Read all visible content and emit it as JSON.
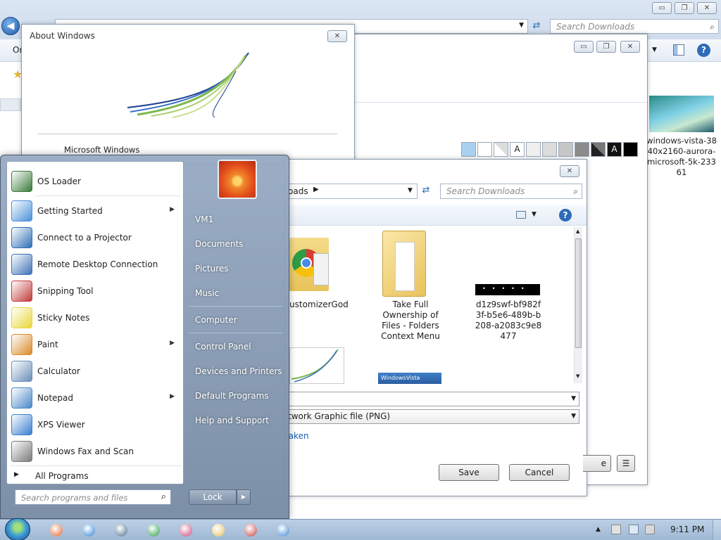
{
  "explorer": {
    "search_placeholder": "Search Downloads",
    "organize_label": "Or",
    "thumbnail_caption": "windows-vista-3840x2160-aurora-microsoft-5k-23361",
    "caption_buttons": {
      "minimize": "▭",
      "restore": "❐",
      "close": "✕"
    }
  },
  "personalization": {
    "caption_buttons": {
      "minimize": "▭",
      "restore": "❐",
      "close": "✕"
    },
    "swatch_colors": [
      "#a9d0ef",
      "#ffffff",
      "#e6e6e6",
      "#f3f3f3",
      "#f0f0f0",
      "#dcdcdc",
      "#c6c6c6",
      "#8b8b8b",
      "#555555",
      "#2e2e2e",
      "#000000"
    ],
    "swatch_letters": {
      "a1": "A",
      "a2": "A"
    }
  },
  "about": {
    "title": "About Windows",
    "product": "Microsoft Windows",
    "close": "✕"
  },
  "save_dialog": {
    "close": "✕",
    "breadcrumb_tail": "oads",
    "search_placeholder": "Search Downloads",
    "files": [
      {
        "label": "ustomizerGod",
        "icon": "chrome-folder-icon"
      },
      {
        "label": "Take Full Ownership of Files - Folders Context Menu",
        "icon": "folder-icon"
      },
      {
        "label": "d1z9swf-bf982f3f-b5e6-489b-b208-a2083c9e8477",
        "icon": "image-thumbnail-icon"
      }
    ],
    "save_as_type": "twork Graphic file (PNG)",
    "tags_link": "taken",
    "save_label": "Save",
    "cancel_label": "Cancel",
    "partial_button": "e",
    "menu_glyph": "☰"
  },
  "start_menu": {
    "programs": [
      {
        "label": "OS Loader",
        "submenu": false,
        "icon": "os-loader-icon",
        "color": "#3b7a3b"
      },
      {
        "label": "Getting Started",
        "submenu": true,
        "icon": "getting-started-icon",
        "color": "#4a90d9"
      },
      {
        "label": "Connect to a Projector",
        "submenu": false,
        "icon": "projector-icon",
        "color": "#2f6fb5"
      },
      {
        "label": "Remote Desktop Connection",
        "submenu": false,
        "icon": "remote-desktop-icon",
        "color": "#3f73b8"
      },
      {
        "label": "Snipping Tool",
        "submenu": false,
        "icon": "scissors-icon",
        "color": "#c23a3a"
      },
      {
        "label": "Sticky Notes",
        "submenu": false,
        "icon": "sticky-notes-icon",
        "color": "#e8d73a"
      },
      {
        "label": "Paint",
        "submenu": true,
        "icon": "paint-icon",
        "color": "#d98b2b"
      },
      {
        "label": "Calculator",
        "submenu": false,
        "icon": "calculator-icon",
        "color": "#6a8fb8"
      },
      {
        "label": "Notepad",
        "submenu": true,
        "icon": "notepad-icon",
        "color": "#4b88c9"
      },
      {
        "label": "XPS Viewer",
        "submenu": false,
        "icon": "xps-viewer-icon",
        "color": "#3a7fcf"
      },
      {
        "label": "Windows Fax and Scan",
        "submenu": false,
        "icon": "fax-icon",
        "color": "#7a7a7a"
      }
    ],
    "all_programs": "All Programs",
    "search_placeholder": "Search programs and files",
    "right_items": [
      "VM1",
      "Documents",
      "Pictures",
      "Music",
      "Computer",
      "Control Panel",
      "Devices and Printers",
      "Default Programs",
      "Help and Support"
    ],
    "lock_label": "Lock",
    "submenu_glyph": "▶",
    "all_programs_glyph": "▶",
    "lock_arrow": "▶"
  },
  "taskbar": {
    "clock": "9:11 PM",
    "pinned": [
      {
        "name": "firefox-icon",
        "color": "#e8622a"
      },
      {
        "name": "internet-explorer-icon",
        "color": "#2f83d6"
      },
      {
        "name": "monitor-app-icon",
        "color": "#4c6c8a"
      },
      {
        "name": "chrome-icon",
        "color": "#2e9b48"
      },
      {
        "name": "flower-settings-icon",
        "color": "#d2457a"
      },
      {
        "name": "file-explorer-icon",
        "color": "#e5c15a"
      },
      {
        "name": "snipping-tool-icon",
        "color": "#c94343"
      },
      {
        "name": "windows-icon",
        "color": "#3b86d8"
      }
    ],
    "tray_chevron": "▲"
  }
}
